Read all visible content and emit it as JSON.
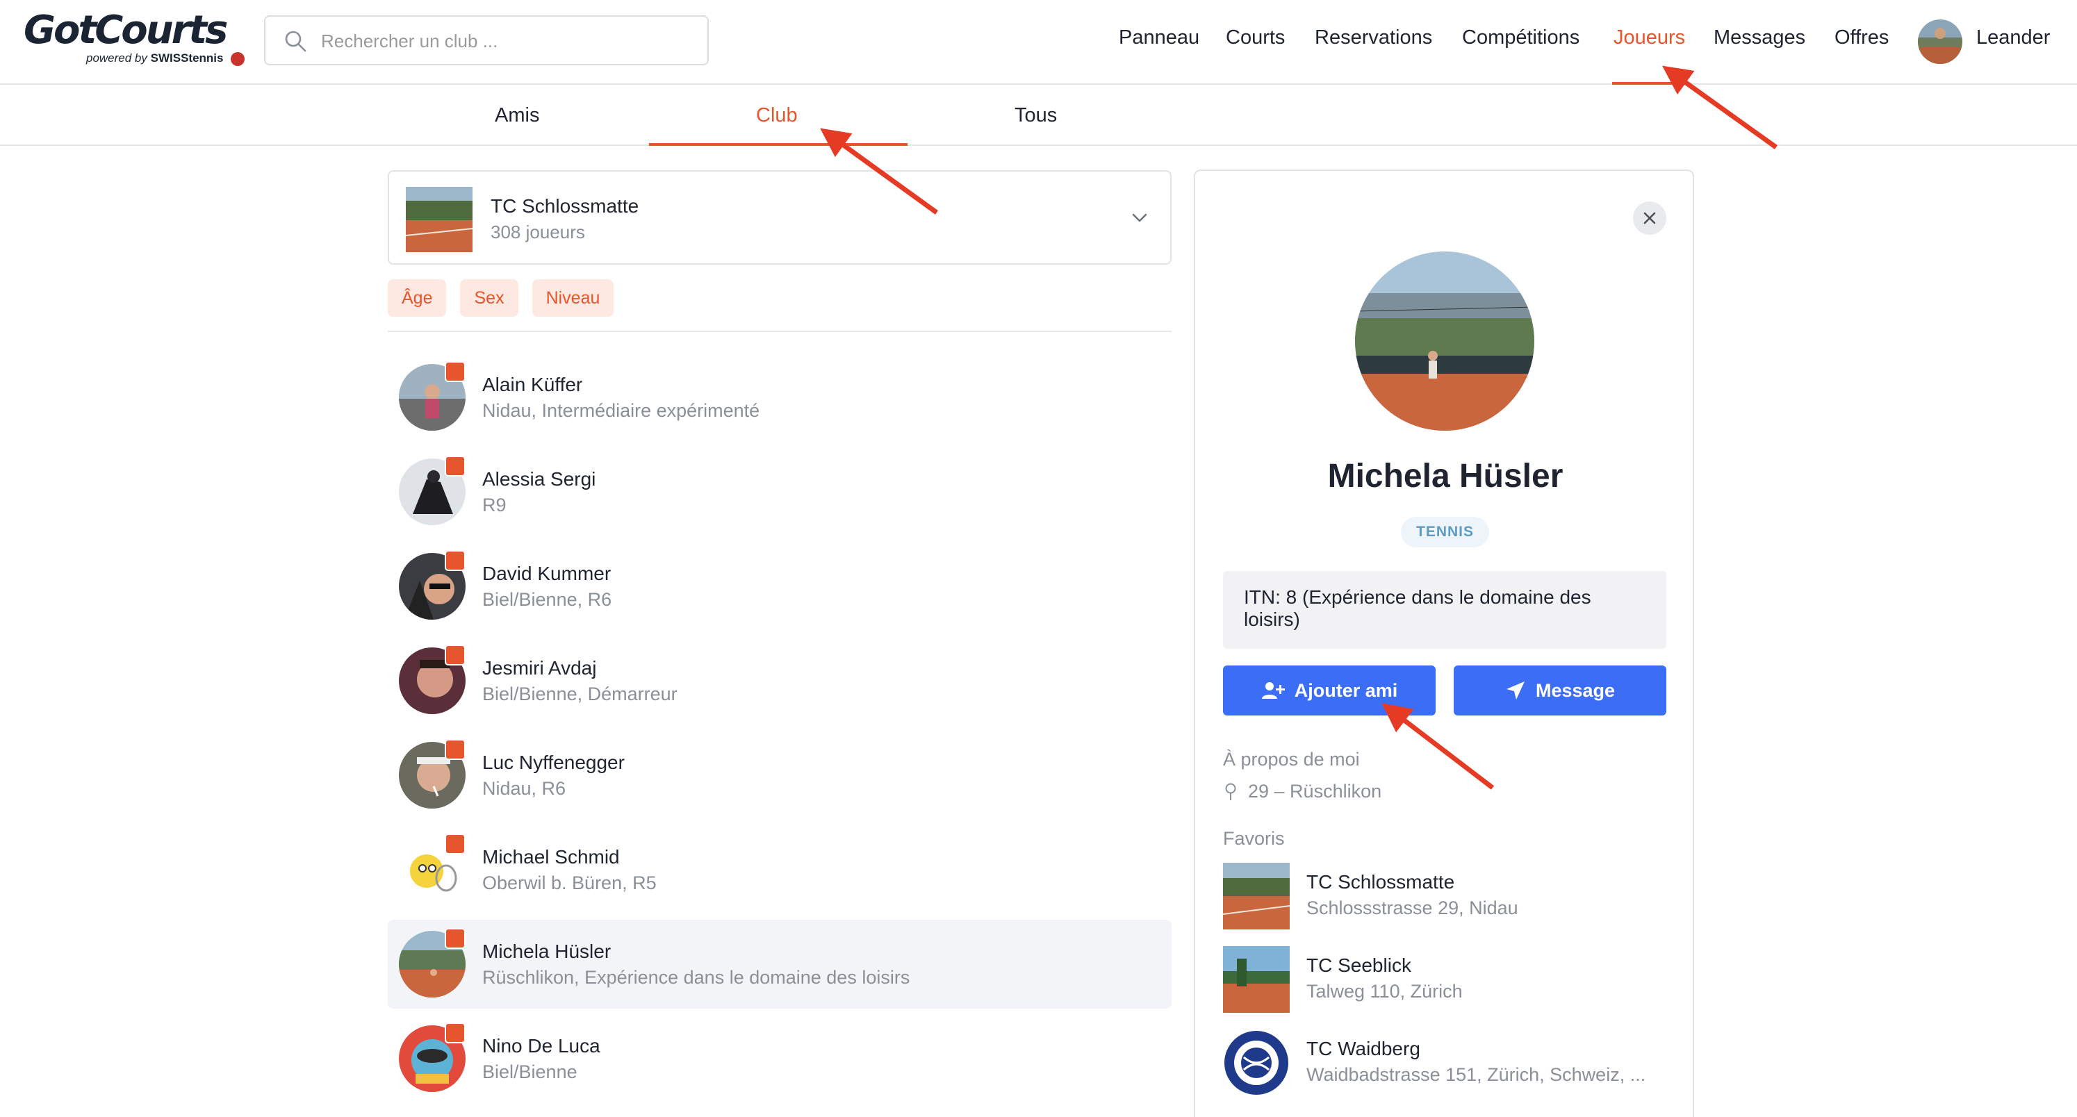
{
  "header": {
    "logo_text": "GotCourts",
    "logo_powered": "powered by",
    "logo_brand": "SWISStennis",
    "search_placeholder": "Rechercher un club ...",
    "nav": [
      "Panneau",
      "Courts",
      "Reservations",
      "Compétitions",
      "Joueurs",
      "Messages",
      "Offres"
    ],
    "active_nav": "Joueurs",
    "user_name": "Leander"
  },
  "subtabs": {
    "items": [
      "Amis",
      "Club",
      "Tous"
    ],
    "active": "Club"
  },
  "club_selector": {
    "name": "TC Schlossmatte",
    "count": "308 joueurs"
  },
  "filters": [
    "Âge",
    "Sex",
    "Niveau"
  ],
  "players": [
    {
      "name": "Alain Küffer",
      "details": "Nidau, Intermédiaire expérimenté"
    },
    {
      "name": "Alessia Sergi",
      "details": "R9"
    },
    {
      "name": "David Kummer",
      "details": "Biel/Bienne, R6"
    },
    {
      "name": "Jesmiri Avdaj",
      "details": "Biel/Bienne, Démarreur"
    },
    {
      "name": "Luc Nyffenegger",
      "details": "Nidau, R6"
    },
    {
      "name": "Michael Schmid",
      "details": "Oberwil b. Büren, R5"
    },
    {
      "name": "Michela Hüsler",
      "details": "Rüschlikon, Expérience dans le domaine des loisirs"
    },
    {
      "name": "Nino De Luca",
      "details": "Biel/Bienne"
    }
  ],
  "selected_player_index": 6,
  "profile": {
    "name": "Michela Hüsler",
    "sport": "TENNIS",
    "itn": "ITN: 8 (Expérience dans le domaine des loisirs)",
    "add_friend_label": "Ajouter ami",
    "message_label": "Message",
    "about_title": "À propos de moi",
    "about_location": "29 – Rüschlikon",
    "favorites_title": "Favoris",
    "favorites": [
      {
        "name": "TC Schlossmatte",
        "address": "Schlossstrasse 29, Nidau"
      },
      {
        "name": "TC Seeblick",
        "address": "Talweg 110, Zürich"
      },
      {
        "name": "TC Waidberg",
        "address": "Waidbadstrasse 151, Zürich, Schweiz, ..."
      }
    ]
  },
  "colors": {
    "accent": "#e8542b",
    "button_blue": "#3b6df5",
    "chip_bg": "#fde9e1",
    "muted_text": "#8a8f98",
    "annotation_arrow": "#e53b25"
  }
}
